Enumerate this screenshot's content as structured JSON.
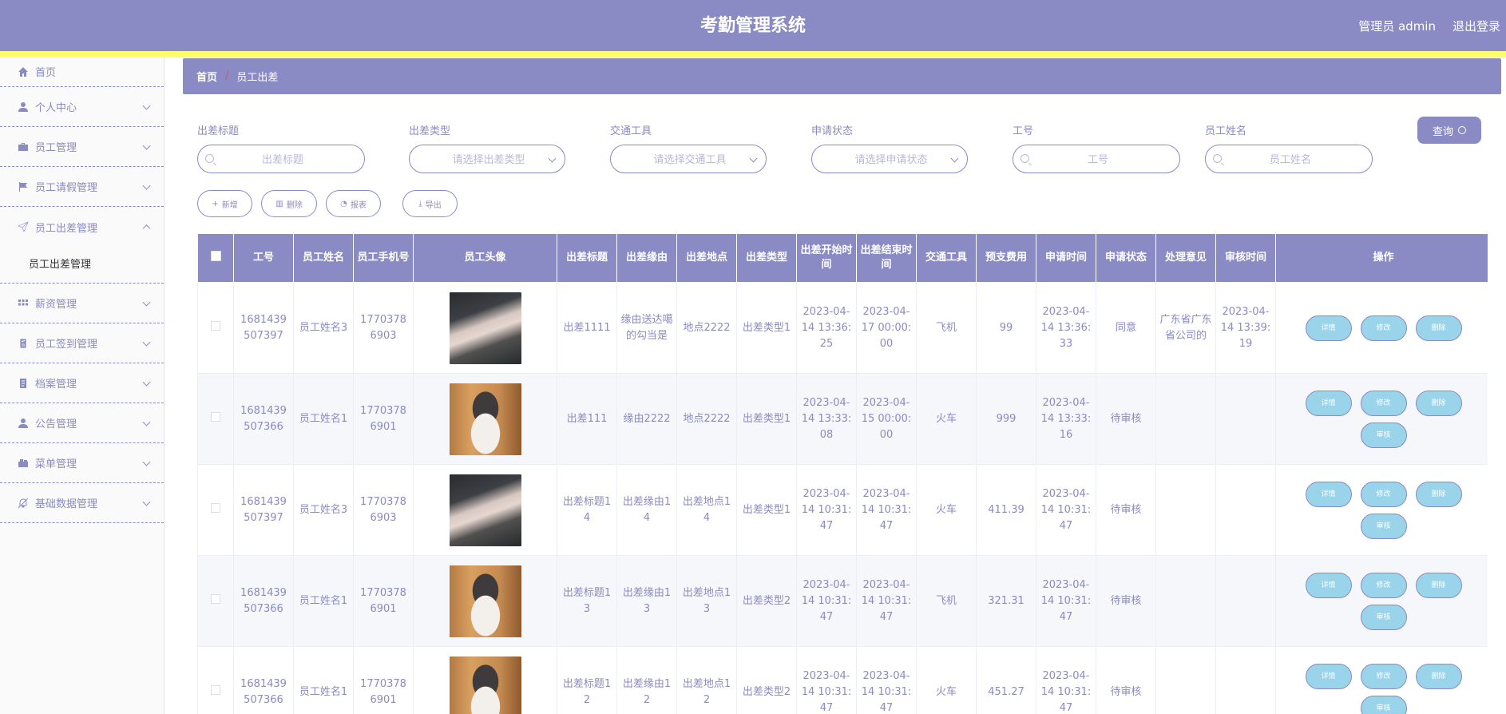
{
  "header": {
    "title": "考勤管理系统",
    "user": "管理员 admin",
    "logout": "退出登录"
  },
  "colors": {
    "primary": "#8a8ac4",
    "accent_line": "#fcfc6c",
    "op_button": "#9ad4ea"
  },
  "sidebar": {
    "items": [
      {
        "label": "首页",
        "icon": "home-icon"
      },
      {
        "label": "个人中心",
        "icon": "user-icon"
      },
      {
        "label": "员工管理",
        "icon": "briefcase-icon"
      },
      {
        "label": "员工请假管理",
        "icon": "flag-icon"
      },
      {
        "label": "员工出差管理",
        "icon": "send-icon",
        "expanded": true
      },
      {
        "label": "薪资管理",
        "icon": "grid-icon"
      },
      {
        "label": "员工签到管理",
        "icon": "checklist-icon"
      },
      {
        "label": "档案管理",
        "icon": "document-icon"
      },
      {
        "label": "公告管理",
        "icon": "user-icon"
      },
      {
        "label": "菜单管理",
        "icon": "menu-icon"
      },
      {
        "label": "基础数据管理",
        "icon": "bell-off-icon"
      }
    ],
    "sub_item": "员工出差管理"
  },
  "breadcrumb": {
    "home": "首页",
    "sep": "/",
    "current": "员工出差"
  },
  "search": {
    "fields": [
      {
        "label": "出差标题",
        "placeholder": "出差标题"
      },
      {
        "label": "出差类型",
        "placeholder": "请选择出差类型"
      },
      {
        "label": "交通工具",
        "placeholder": "请选择交通工具"
      },
      {
        "label": "申请状态",
        "placeholder": "请选择申请状态"
      },
      {
        "label": "工号",
        "placeholder": "工号"
      },
      {
        "label": "员工姓名",
        "placeholder": "员工姓名"
      }
    ],
    "query_label": "查询"
  },
  "actions": {
    "add": "新增",
    "delete": "删除",
    "report": "报表",
    "export": "导出"
  },
  "table": {
    "headers": [
      "工号",
      "员工姓名",
      "员工手机号",
      "员工头像",
      "出差标题",
      "出差缘由",
      "出差地点",
      "出差类型",
      "出差开始时间",
      "出差结束时间",
      "交通工具",
      "预支费用",
      "申请时间",
      "申请状态",
      "处理意见",
      "审核时间",
      "操作"
    ],
    "rows": [
      {
        "id": "1681439507397",
        "name": "员工姓名3",
        "phone": "17703786903",
        "avatar": "girl",
        "title": "出差1111",
        "reason": "缘由送达噶的勾当是",
        "place": "地点2222",
        "type": "出差类型1",
        "start": "2023-04-14 13:36:25",
        "end": "2023-04-17 00:00:00",
        "transport": "飞机",
        "cost": "99",
        "apply_time": "2023-04-14 13:36:33",
        "status": "同意",
        "opinion": "广东省广东省公司的",
        "review_time": "2023-04-14 13:39:19",
        "ops": [
          "详情",
          "修改",
          "删除"
        ]
      },
      {
        "id": "1681439507366",
        "name": "员工姓名1",
        "phone": "17703786901",
        "avatar": "cat",
        "title": "出差111",
        "reason": "缘由2222",
        "place": "地点2222",
        "type": "出差类型1",
        "start": "2023-04-14 13:33:08",
        "end": "2023-04-15 00:00:00",
        "transport": "火车",
        "cost": "999",
        "apply_time": "2023-04-14 13:33:16",
        "status": "待审核",
        "opinion": "",
        "review_time": "",
        "ops": [
          "详情",
          "修改",
          "删除",
          "审核"
        ]
      },
      {
        "id": "1681439507397",
        "name": "员工姓名3",
        "phone": "17703786903",
        "avatar": "girl",
        "title": "出差标题14",
        "reason": "出差缘由14",
        "place": "出差地点14",
        "type": "出差类型1",
        "start": "2023-04-14 10:31:47",
        "end": "2023-04-14 10:31:47",
        "transport": "火车",
        "cost": "411.39",
        "apply_time": "2023-04-14 10:31:47",
        "status": "待审核",
        "opinion": "",
        "review_time": "",
        "ops": [
          "详情",
          "修改",
          "删除",
          "审核"
        ]
      },
      {
        "id": "1681439507366",
        "name": "员工姓名1",
        "phone": "17703786901",
        "avatar": "cat",
        "title": "出差标题13",
        "reason": "出差缘由13",
        "place": "出差地点13",
        "type": "出差类型2",
        "start": "2023-04-14 10:31:47",
        "end": "2023-04-14 10:31:47",
        "transport": "飞机",
        "cost": "321.31",
        "apply_time": "2023-04-14 10:31:47",
        "status": "待审核",
        "opinion": "",
        "review_time": "",
        "ops": [
          "详情",
          "修改",
          "删除",
          "审核"
        ]
      },
      {
        "id": "1681439507366",
        "name": "员工姓名1",
        "phone": "17703786901",
        "avatar": "cat",
        "title": "出差标题12",
        "reason": "出差缘由12",
        "place": "出差地点12",
        "type": "出差类型2",
        "start": "2023-04-14 10:31:47",
        "end": "2023-04-14 10:31:47",
        "transport": "火车",
        "cost": "451.27",
        "apply_time": "2023-04-14 10:31:47",
        "status": "待审核",
        "opinion": "",
        "review_time": "",
        "ops": [
          "详情",
          "修改",
          "删除",
          "审核"
        ]
      }
    ]
  }
}
